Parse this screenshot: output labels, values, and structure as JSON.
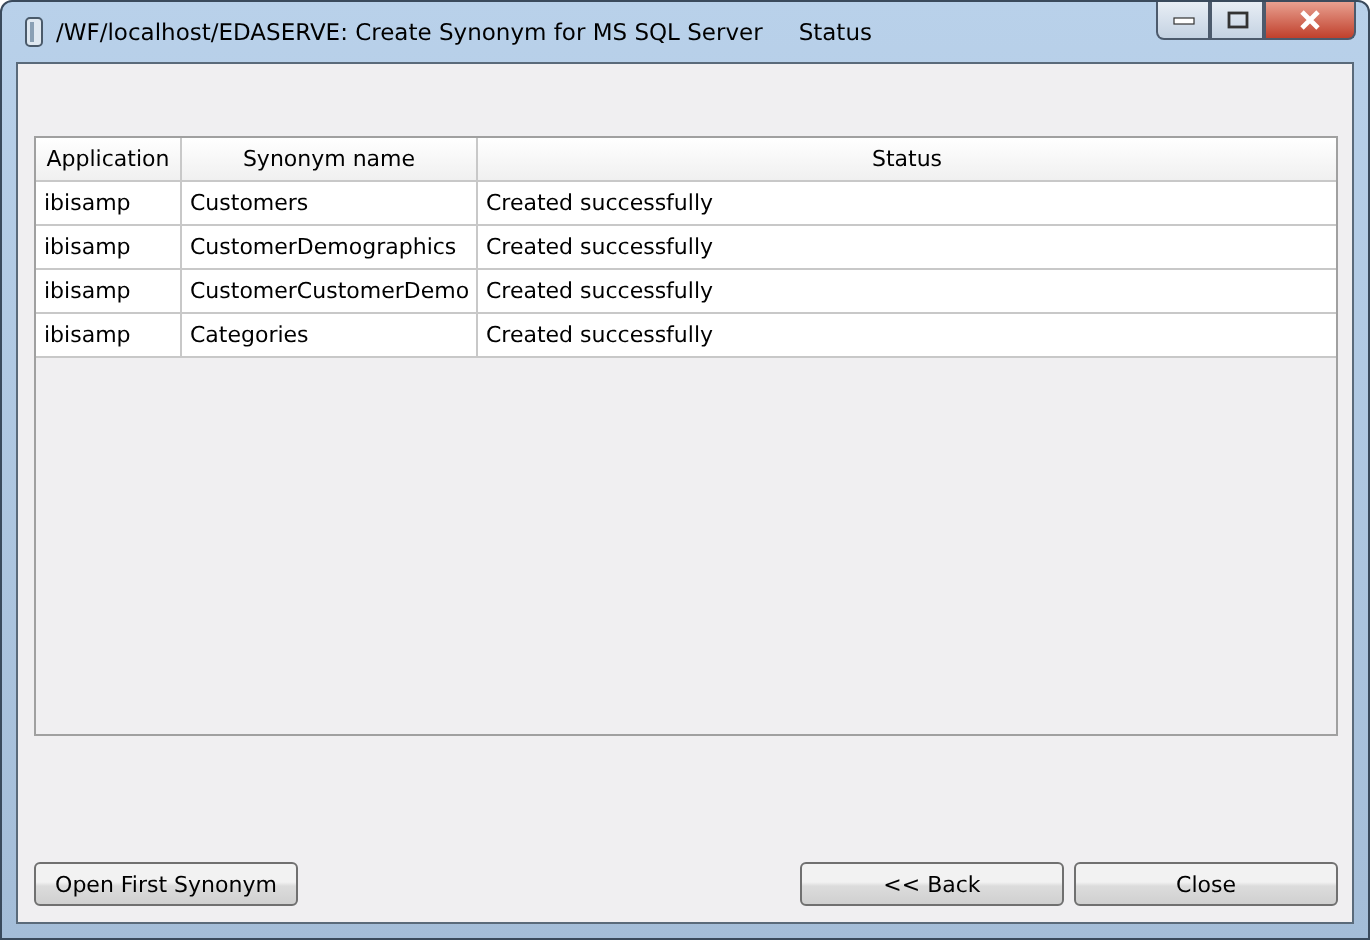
{
  "window": {
    "title": "/WF/localhost/EDASERVE: Create Synonym for MS SQL Server",
    "subtitle": "Status"
  },
  "table": {
    "columns": [
      "Application",
      "Synonym name",
      "Status"
    ],
    "rows": [
      [
        "ibisamp",
        "Customers",
        "Created successfully"
      ],
      [
        "ibisamp",
        "CustomerDemographics",
        "Created successfully"
      ],
      [
        "ibisamp",
        "CustomerCustomerDemo",
        "Created successfully"
      ],
      [
        "ibisamp",
        "Categories",
        "Created successfully"
      ]
    ]
  },
  "buttons": {
    "left": [
      "Open First Synonym"
    ],
    "right": [
      "<< Back",
      "Close"
    ]
  }
}
